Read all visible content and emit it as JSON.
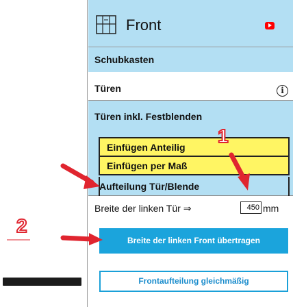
{
  "header": {
    "title": "Front"
  },
  "sections": {
    "schubkasten": "Schubkasten",
    "tueren": "Türen",
    "tueren_festblenden": "Türen inkl. Festblenden"
  },
  "submenu": {
    "einfuegen_anteilig": "Einfügen Anteilig",
    "einfuegen_mass": "Einfügen per Maß",
    "aufteilung": "Aufteilung Tür/Blende"
  },
  "breite": {
    "label": "Breite der linken Tür ⇒",
    "value": "450",
    "unit": "mm"
  },
  "buttons": {
    "uebertragen": "Breite der linken Front übertragen",
    "gleichmaessig": "Frontaufteilung gleichmäßig"
  },
  "annotations": {
    "num1": "1",
    "num2": "2"
  },
  "colors": {
    "panel_blue": "#b3dff3",
    "yellow": "#fff563",
    "button_blue": "#1ba4dc",
    "arrow_red": "#e0252f"
  }
}
